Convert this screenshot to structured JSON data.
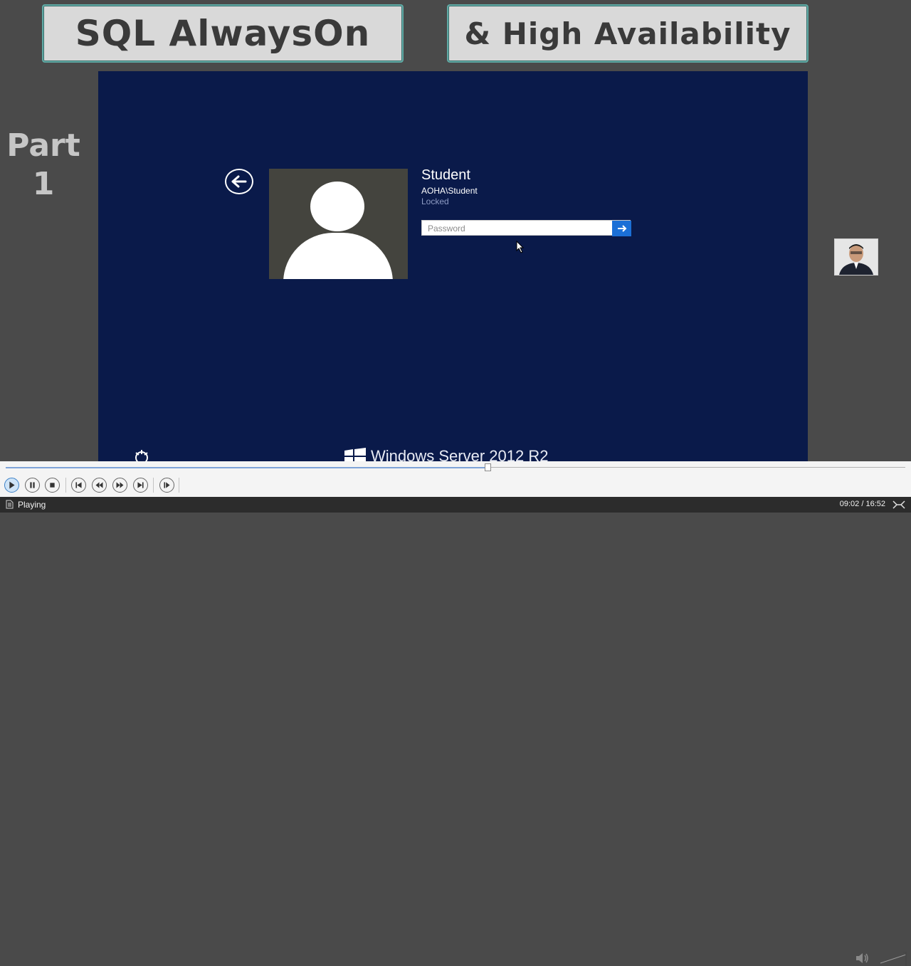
{
  "slide": {
    "title_left": "SQL AlwaysOn",
    "title_right": "& High Availability",
    "part_label": "Part",
    "part_number": "1"
  },
  "lock_screen": {
    "user_name": "Student",
    "user_account": "AOHA\\Student",
    "user_status": "Locked",
    "password_placeholder": "Password",
    "brand_text": "Windows Server 2012 R2"
  },
  "player": {
    "seek_progress": 0.536,
    "status": "Playing",
    "time_display": "09:02 / 16:52",
    "controls": [
      "play-icon",
      "pause-icon",
      "stop-icon",
      "previous-track-icon",
      "rewind-icon",
      "fast-forward-icon",
      "next-track-icon",
      "frame-step-icon"
    ],
    "accent_color": "#3e82c8"
  }
}
